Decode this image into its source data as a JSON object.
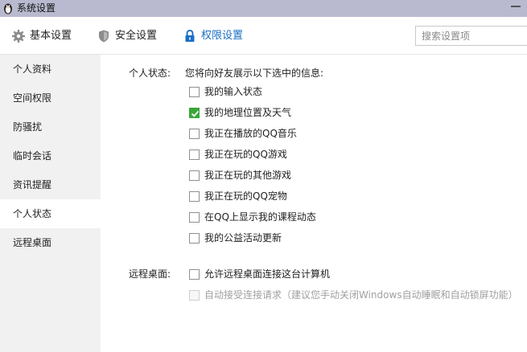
{
  "window": {
    "title": "系统设置",
    "logo_icon": "penguin-logo-icon",
    "minimize_icon": "minimize-icon"
  },
  "toolbar": {
    "tabs": [
      {
        "label": "基本设置",
        "icon": "gear-icon",
        "active": false
      },
      {
        "label": "安全设置",
        "icon": "shield-icon",
        "active": false
      },
      {
        "label": "权限设置",
        "icon": "lock-icon",
        "active": true
      }
    ],
    "accent_color": "#1a6fc4",
    "search": {
      "placeholder": "搜索设置项",
      "value": ""
    }
  },
  "sidebar": {
    "items": [
      {
        "label": "个人资料",
        "active": false
      },
      {
        "label": "空间权限",
        "active": false
      },
      {
        "label": "防骚扰",
        "active": false
      },
      {
        "label": "临时会话",
        "active": false
      },
      {
        "label": "资讯提醒",
        "active": false
      },
      {
        "label": "个人状态",
        "active": true
      },
      {
        "label": "远程桌面",
        "active": false
      }
    ]
  },
  "personal_status": {
    "label": "个人状态:",
    "description": "您将向好友展示以下选中的信息:",
    "options": [
      {
        "label": "我的输入状态",
        "checked": false
      },
      {
        "label": "我的地理位置及天气",
        "checked": true
      },
      {
        "label": "我正在播放的QQ音乐",
        "checked": false
      },
      {
        "label": "我正在玩的QQ游戏",
        "checked": false
      },
      {
        "label": "我正在玩的其他游戏",
        "checked": false
      },
      {
        "label": "我正在玩的QQ宠物",
        "checked": false
      },
      {
        "label": "在QQ上显示我的课程动态",
        "checked": false
      },
      {
        "label": "我的公益活动更新",
        "checked": false
      }
    ]
  },
  "remote_desktop": {
    "label": "远程桌面:",
    "options": [
      {
        "label": "允许远程桌面连接这台计算机",
        "checked": false,
        "disabled": false
      },
      {
        "label": "自动接受连接请求（建议您手动关闭Windows自动睡眠和自动锁屏功能）",
        "checked": false,
        "disabled": true
      }
    ]
  },
  "colors": {
    "checkbox_checked": "#3aa63a",
    "titlebar": "#b9b9cf",
    "sidebar_bg": "#f1f1f1"
  }
}
